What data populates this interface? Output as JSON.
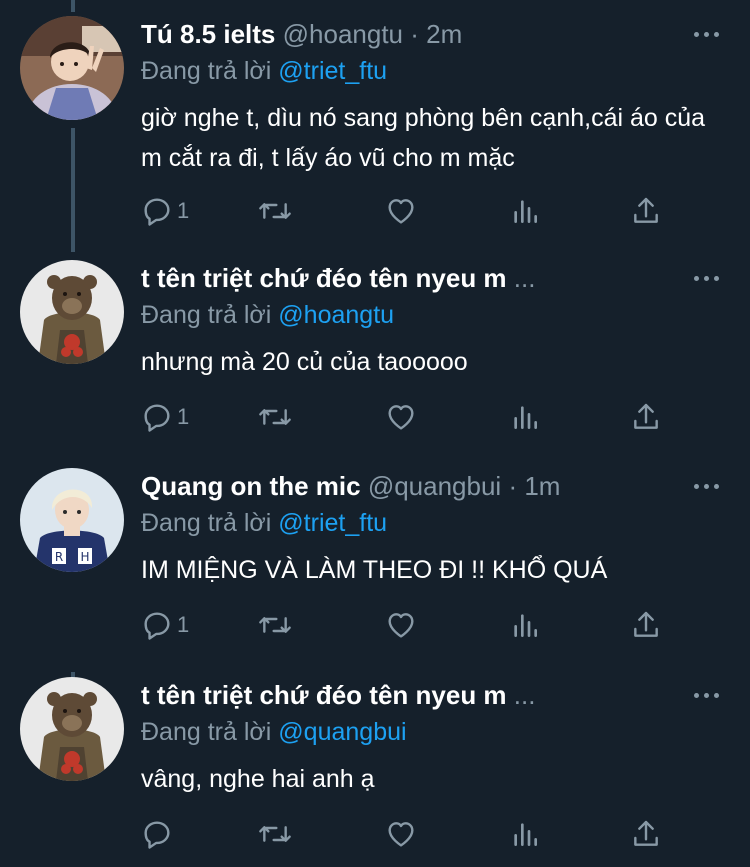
{
  "tweets": [
    {
      "name": "Tú 8.5 ielts",
      "handle": "@hoangtu",
      "separator": "·",
      "time": "2m",
      "replying_label": "Đang trả lời",
      "replying_to": "@triet_ftu",
      "body": "giờ nghe t, dìu nó sang phòng bên cạnh,cái áo của m cắt ra đi, t lấy áo vũ cho m mặc",
      "reply_count": "1",
      "avatar_icon": "profile-photo-boy-peace-sign"
    },
    {
      "name": "t tên triệt chứ đéo tên nyeu m",
      "name_ellipsis": "...",
      "replying_label": "Đang trả lời",
      "replying_to": "@hoangtu",
      "body": "nhưng mà 20 củ của taooooo",
      "reply_count": "1",
      "avatar_icon": "profile-photo-person-with-bear-mask"
    },
    {
      "name": "Quang on the mic",
      "handle": "@quangbui",
      "separator": "·",
      "time": "1m",
      "replying_label": "Đang trả lời",
      "replying_to": "@triet_ftu",
      "body": "IM MIỆNG VÀ LÀM THEO ĐI !! KHỔ QUÁ",
      "reply_count": "1",
      "avatar_icon": "profile-photo-blond-boy-varsity-jacket"
    },
    {
      "name": "t tên triệt chứ đéo tên nyeu m",
      "name_ellipsis": "...",
      "replying_label": "Đang trả lời",
      "replying_to": "@quangbui",
      "body": "vâng, nghe hai anh ạ",
      "reply_count": "",
      "avatar_icon": "profile-photo-person-with-bear-mask"
    }
  ],
  "colors": {
    "background": "#15202b",
    "primary_text": "#ffffff",
    "secondary_text": "#8899a6",
    "accent": "#1da1f2",
    "thread_line": "#3d5466"
  }
}
